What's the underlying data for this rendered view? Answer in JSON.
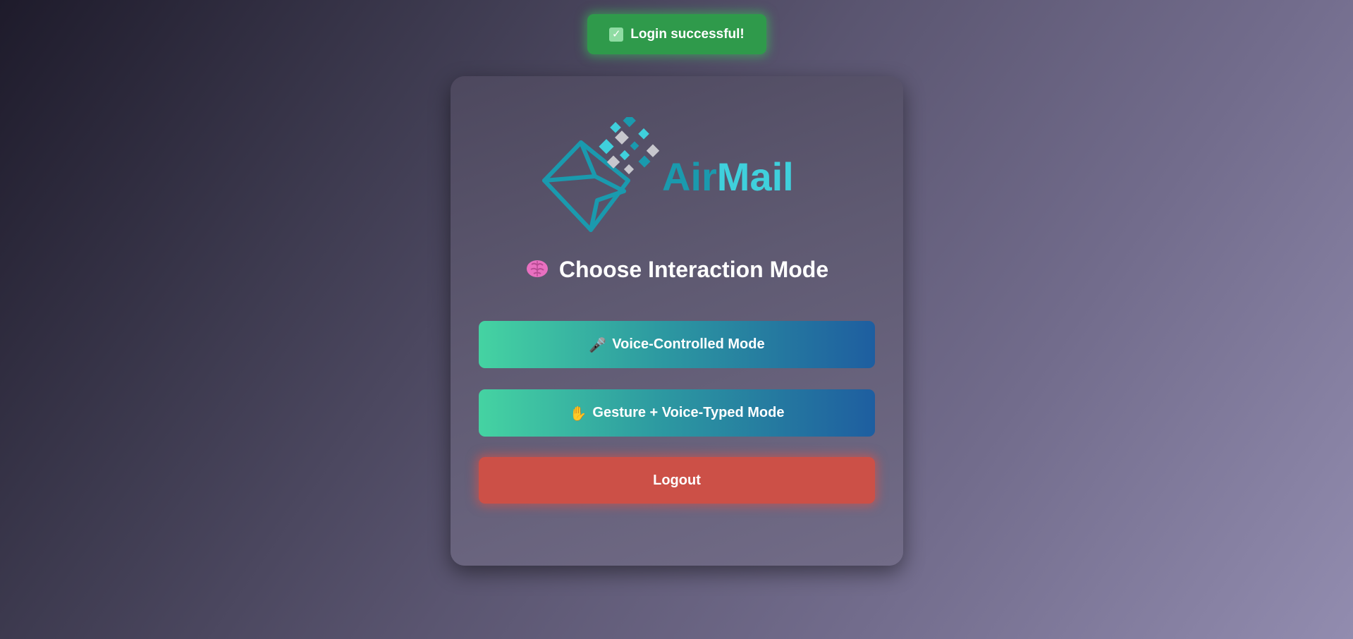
{
  "toast": {
    "icon": "check-box-icon",
    "message": "Login successful!"
  },
  "logo": {
    "text_left": "Air",
    "text_right": "Mail",
    "color_dark": "#1a9aae",
    "color_light": "#3fd0dc"
  },
  "heading": {
    "icon": "brain-icon",
    "title": "Choose Interaction Mode"
  },
  "buttons": {
    "voice": {
      "icon": "microphone-icon",
      "label": "Voice-Controlled Mode"
    },
    "gesture": {
      "icon": "raised-hand-icon",
      "label": "Gesture + Voice-Typed Mode"
    },
    "logout": {
      "label": "Logout"
    }
  },
  "colors": {
    "toast_bg": "#2f9a4b",
    "button_gradient_start": "#45d3a2",
    "button_gradient_end": "#1e5ea0",
    "logout_bg": "#cc5047"
  }
}
